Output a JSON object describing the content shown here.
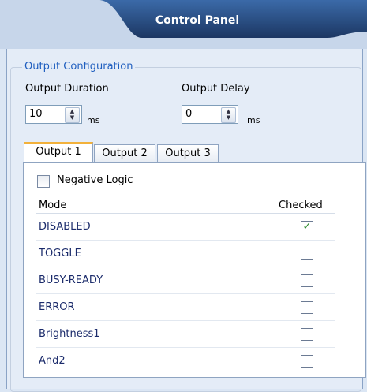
{
  "header": {
    "title": "Control Panel"
  },
  "output_config": {
    "title": "Output Configuration",
    "duration": {
      "label": "Output Duration",
      "value": "10",
      "unit": "ms"
    },
    "delay": {
      "label": "Output Delay",
      "value": "0",
      "unit": "ms"
    }
  },
  "tabs": [
    {
      "label": "Output 1",
      "active": true
    },
    {
      "label": "Output 2",
      "active": false
    },
    {
      "label": "Output 3",
      "active": false
    }
  ],
  "negative_logic": {
    "label": "Negative Logic",
    "checked": false
  },
  "grid": {
    "columns": [
      "Mode",
      "Checked"
    ],
    "rows": [
      {
        "mode": "DISABLED",
        "checked": true
      },
      {
        "mode": "TOGGLE",
        "checked": false
      },
      {
        "mode": "BUSY-READY",
        "checked": false
      },
      {
        "mode": "ERROR",
        "checked": false
      },
      {
        "mode": "Brightness1",
        "checked": false
      },
      {
        "mode": "And2",
        "checked": false
      }
    ]
  },
  "colors": {
    "header_tab": "#1f3f73",
    "group_title": "#1f5ebf",
    "active_tab_accent": "#f2b13b",
    "check_mark": "#2a8a2a"
  },
  "icons": [
    "spin-up-icon",
    "spin-down-icon",
    "check-mark-icon"
  ]
}
